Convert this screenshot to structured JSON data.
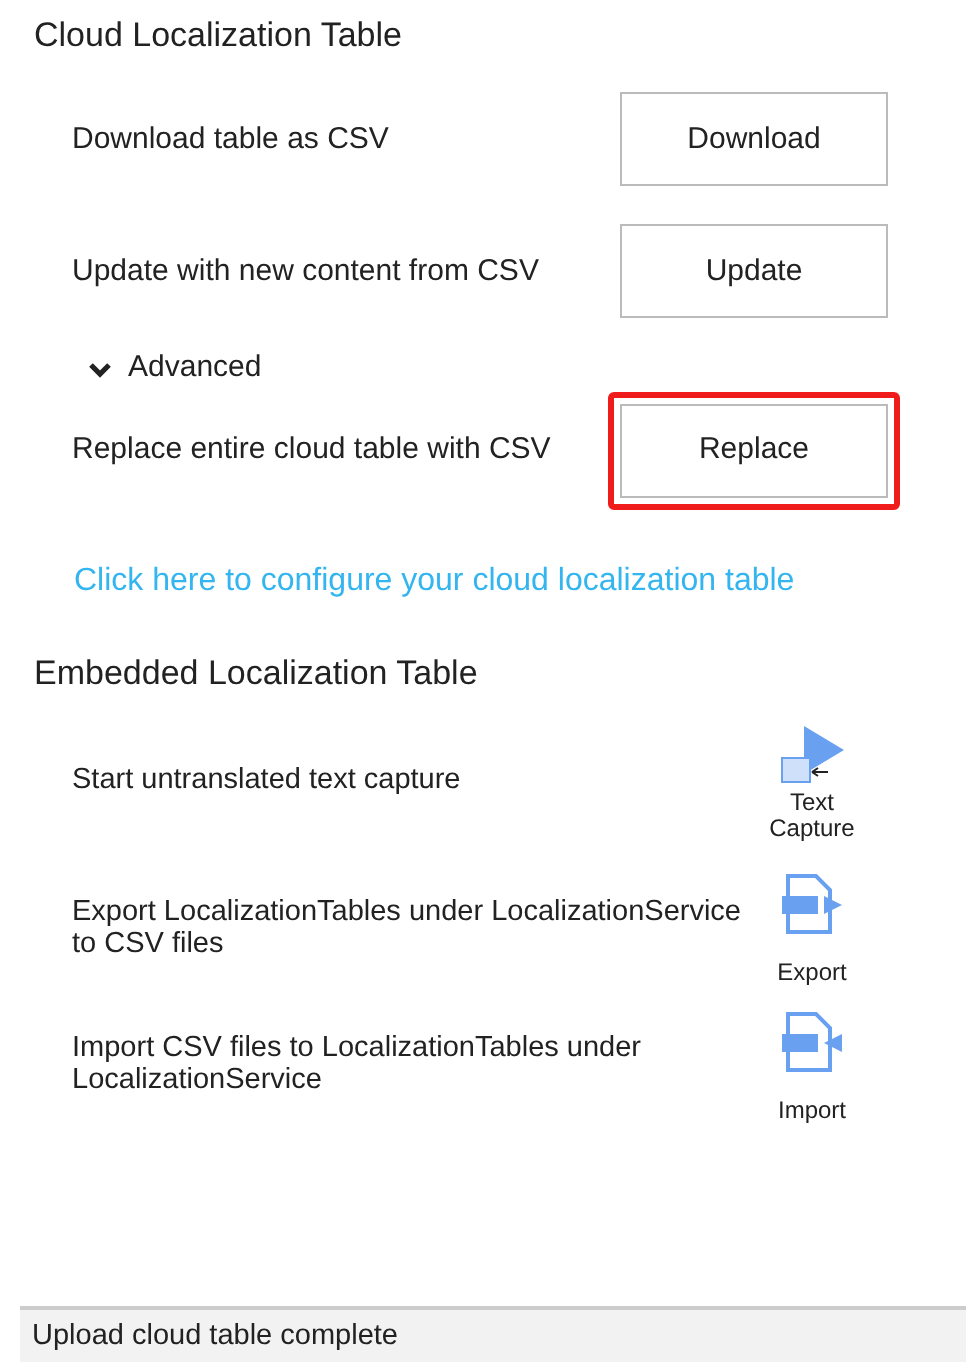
{
  "cloud_section": {
    "title": "Cloud Localization Table",
    "actions": [
      {
        "label": "Download table as CSV",
        "button": "Download",
        "highlighted": false
      },
      {
        "label": "Update with new content from CSV",
        "button": "Update",
        "highlighted": false
      }
    ],
    "advanced": {
      "label": "Advanced",
      "expanded": true,
      "actions": [
        {
          "label": "Replace entire cloud table with CSV",
          "button": "Replace",
          "highlighted": true
        }
      ]
    },
    "link": "Click here to configure your cloud localization table"
  },
  "embedded_section": {
    "title": "Embedded Localization Table",
    "tools": [
      {
        "description": "Start untranslated text capture",
        "kind": "capture",
        "label": "Text Capture"
      },
      {
        "description": "Export LocalizationTables under LocalizationService to CSV files",
        "kind": "export",
        "label": "Export"
      },
      {
        "description": "Import CSV files to LocalizationTables under LocalizationService",
        "kind": "import",
        "label": "Import"
      }
    ]
  },
  "status_bar": "Upload cloud table complete"
}
